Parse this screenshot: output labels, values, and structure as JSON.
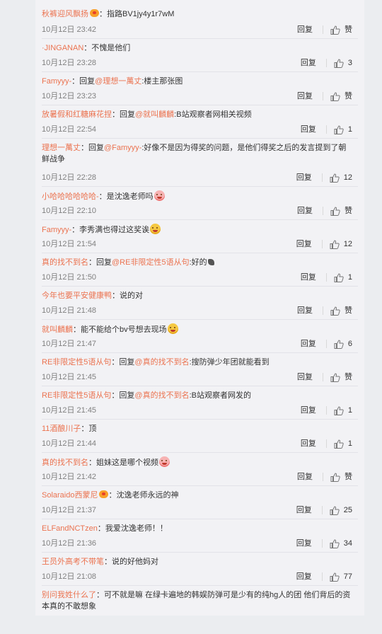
{
  "reply_label": "回复",
  "comments": [
    {
      "user": "秋裤迎风飘扬",
      "badge": true,
      "pre": "",
      "mention": "",
      "text": "：指路BV1jy4y1r7wM",
      "emoji": "",
      "time": "10月12日 23:42",
      "likes": "赞"
    },
    {
      "user": "·JINGANAN",
      "badge": false,
      "pre": "",
      "mention": "",
      "text": "：不愧是他们",
      "emoji": "",
      "time": "10月12日 23:28",
      "likes": "3"
    },
    {
      "user": "Famyyy-",
      "badge": false,
      "pre": "：回复",
      "mention": "@理想一萬丈",
      "text": ":楼主那张图",
      "emoji": "",
      "time": "10月12日 23:23",
      "likes": "赞"
    },
    {
      "user": "放暑假和红糖麻花捏",
      "badge": false,
      "pre": "：回复",
      "mention": "@就叫麟麟",
      "text": ":B站观察者网相关视频",
      "emoji": "",
      "time": "10月12日 22:54",
      "likes": "1"
    },
    {
      "user": "理想一萬丈",
      "badge": false,
      "pre": "：回复",
      "mention": "@Famyyy-",
      "text": ":好像不是因为得奖的问题，是他们得奖之后的发言提到了朝鲜战争",
      "emoji": "",
      "time": "10月12日 22:28",
      "likes": "12",
      "two_line": true
    },
    {
      "user": "小哈哈哈哈哈哈-",
      "badge": false,
      "pre": "",
      "mention": "",
      "text": "：是沈逸老师吗",
      "emoji": "blush",
      "time": "10月12日 22:10",
      "likes": "赞"
    },
    {
      "user": "Famyyy-",
      "badge": false,
      "pre": "",
      "mention": "",
      "text": "：李秀满也得过这奖诶",
      "emoji": "laugh",
      "time": "10月12日 21:54",
      "likes": "12"
    },
    {
      "user": "真的找不到名",
      "badge": false,
      "pre": "：回复",
      "mention": "@RE非限定性5语从句",
      "text": ":好的",
      "emoji": "small",
      "time": "10月12日 21:50",
      "likes": "1"
    },
    {
      "user": "今年也要平安健康鸭",
      "badge": false,
      "pre": "",
      "mention": "",
      "text": "：说的对",
      "emoji": "",
      "time": "10月12日 21:48",
      "likes": "赞"
    },
    {
      "user": "就叫麟麟",
      "badge": false,
      "pre": "",
      "mention": "",
      "text": "：能不能给个bv号想去现场",
      "emoji": "laugh",
      "time": "10月12日 21:47",
      "likes": "6"
    },
    {
      "user": "RE非限定性5语从句",
      "badge": false,
      "pre": "：回复",
      "mention": "@真的找不到名",
      "text": ":搜防弹少年团就能看到",
      "emoji": "",
      "time": "10月12日 21:45",
      "likes": "赞"
    },
    {
      "user": "RE非限定性5语从句",
      "badge": false,
      "pre": "：回复",
      "mention": "@真的找不到名",
      "text": ":B站观察者网发的",
      "emoji": "",
      "time": "10月12日 21:45",
      "likes": "1"
    },
    {
      "user": "11酒酿川子",
      "badge": false,
      "pre": "",
      "mention": "",
      "text": "：顶",
      "emoji": "",
      "time": "10月12日 21:44",
      "likes": "1"
    },
    {
      "user": "真的找不到名",
      "badge": false,
      "pre": "",
      "mention": "",
      "text": "：姐妹这是哪个视频",
      "emoji": "blush",
      "time": "10月12日 21:42",
      "likes": "赞"
    },
    {
      "user": "Solaraido西蒙尼",
      "badge": true,
      "pre": "",
      "mention": "",
      "text": "：沈逸老师永远的神",
      "emoji": "",
      "time": "10月12日 21:37",
      "likes": "25"
    },
    {
      "user": "ELFandNCTzen",
      "badge": false,
      "pre": "",
      "mention": "",
      "text": "：我爱沈逸老师！！",
      "emoji": "",
      "time": "10月12日 21:36",
      "likes": "34"
    },
    {
      "user": "王员外高考不带笔",
      "badge": false,
      "pre": "",
      "mention": "",
      "text": "：说的好他妈对",
      "emoji": "",
      "time": "10月12日 21:08",
      "likes": "77"
    },
    {
      "user": "别问我姓什么了",
      "badge": false,
      "pre": "",
      "mention": "",
      "text": "：可不就是嘛 在绿卡遍地的韩娱防弹可是少有的纯hg人的团 他们背后的资本真的不敢想象",
      "emoji": "",
      "time": "",
      "likes": "",
      "two_line": true,
      "partial": true
    }
  ]
}
